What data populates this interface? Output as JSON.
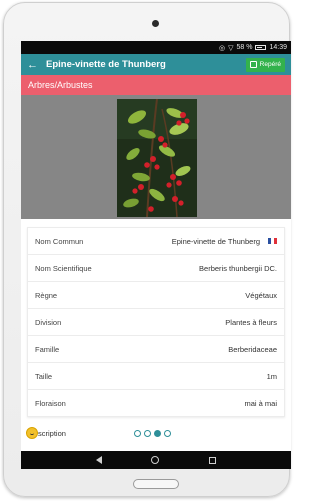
{
  "status_bar": {
    "battery": "58 %",
    "time": "14:39"
  },
  "app_bar": {
    "title": "Epine-vinette de Thunberg",
    "action_label": "Repéré"
  },
  "category": "Arbres/Arbustes",
  "details": [
    {
      "label": "Nom Commun",
      "value": "Epine-vinette de Thunberg"
    },
    {
      "label": "Nom Scientifique",
      "value": "Berberis thunbergii DC."
    },
    {
      "label": "Règne",
      "value": "Végétaux"
    },
    {
      "label": "Division",
      "value": "Plantes à fleurs"
    },
    {
      "label": "Famille",
      "value": "Berberidaceae"
    },
    {
      "label": "Taille",
      "value": "1m"
    },
    {
      "label": "Floraison",
      "value": "mai à mai"
    }
  ],
  "description_label": "scription",
  "carousel": {
    "count": 4,
    "active": 3
  },
  "colors": {
    "app_bar": "#2e8f99",
    "category_bar": "#ec5f6d",
    "action_button": "#33b24c"
  },
  "icons": {
    "back": "arrow-left-icon",
    "action": "checkbox-icon",
    "flag": "flag-fr-icon"
  }
}
